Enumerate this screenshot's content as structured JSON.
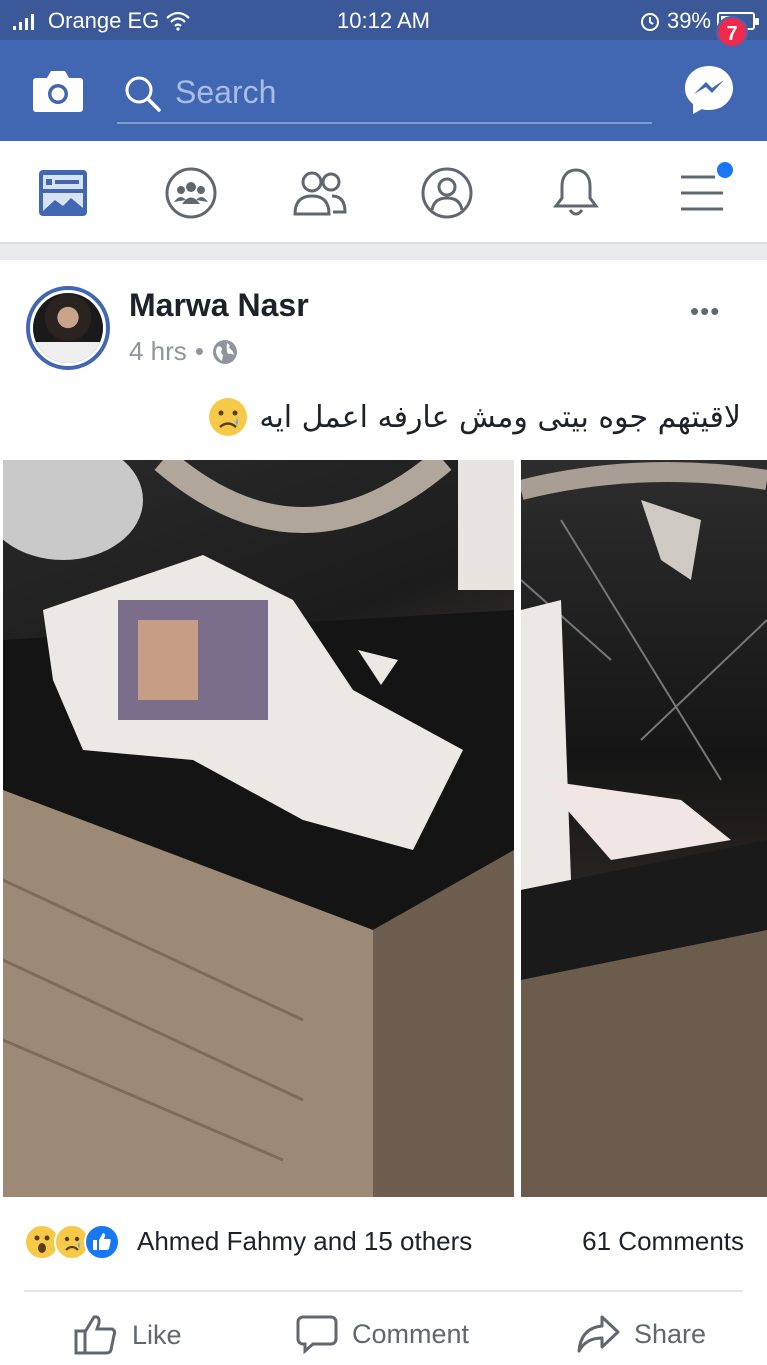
{
  "status_bar": {
    "carrier": "Orange EG",
    "time": "10:12 AM",
    "battery": "39%",
    "battery_level": 0.39
  },
  "header": {
    "search_placeholder": "Search",
    "messenger_badge": "7",
    "brand_color": "#4267b2"
  },
  "tabs": [
    {
      "name": "news-feed",
      "icon": "news-feed-icon",
      "active": true
    },
    {
      "name": "groups",
      "icon": "groups-icon"
    },
    {
      "name": "friends",
      "icon": "friends-icon"
    },
    {
      "name": "profile",
      "icon": "profile-icon"
    },
    {
      "name": "notifications",
      "icon": "bell-icon"
    },
    {
      "name": "menu",
      "icon": "menu-icon",
      "has_dot": true
    }
  ],
  "post": {
    "author": "Marwa Nasr",
    "time": "4 hrs",
    "separator": "•",
    "privacy_icon": "globe-icon",
    "more_label": "•••",
    "caption": "لاقيتهم جوه بيتى ومش عارفه اعمل ايه",
    "caption_emoji": "sad-tear-emoji",
    "reactions": {
      "icons": [
        "wow-emoji",
        "sad-emoji",
        "like-icon"
      ],
      "names": "Ahmed Fahmy and 15 others",
      "comments": "61 Comments"
    },
    "actions": {
      "like": "Like",
      "comment": "Comment",
      "share": "Share"
    }
  }
}
